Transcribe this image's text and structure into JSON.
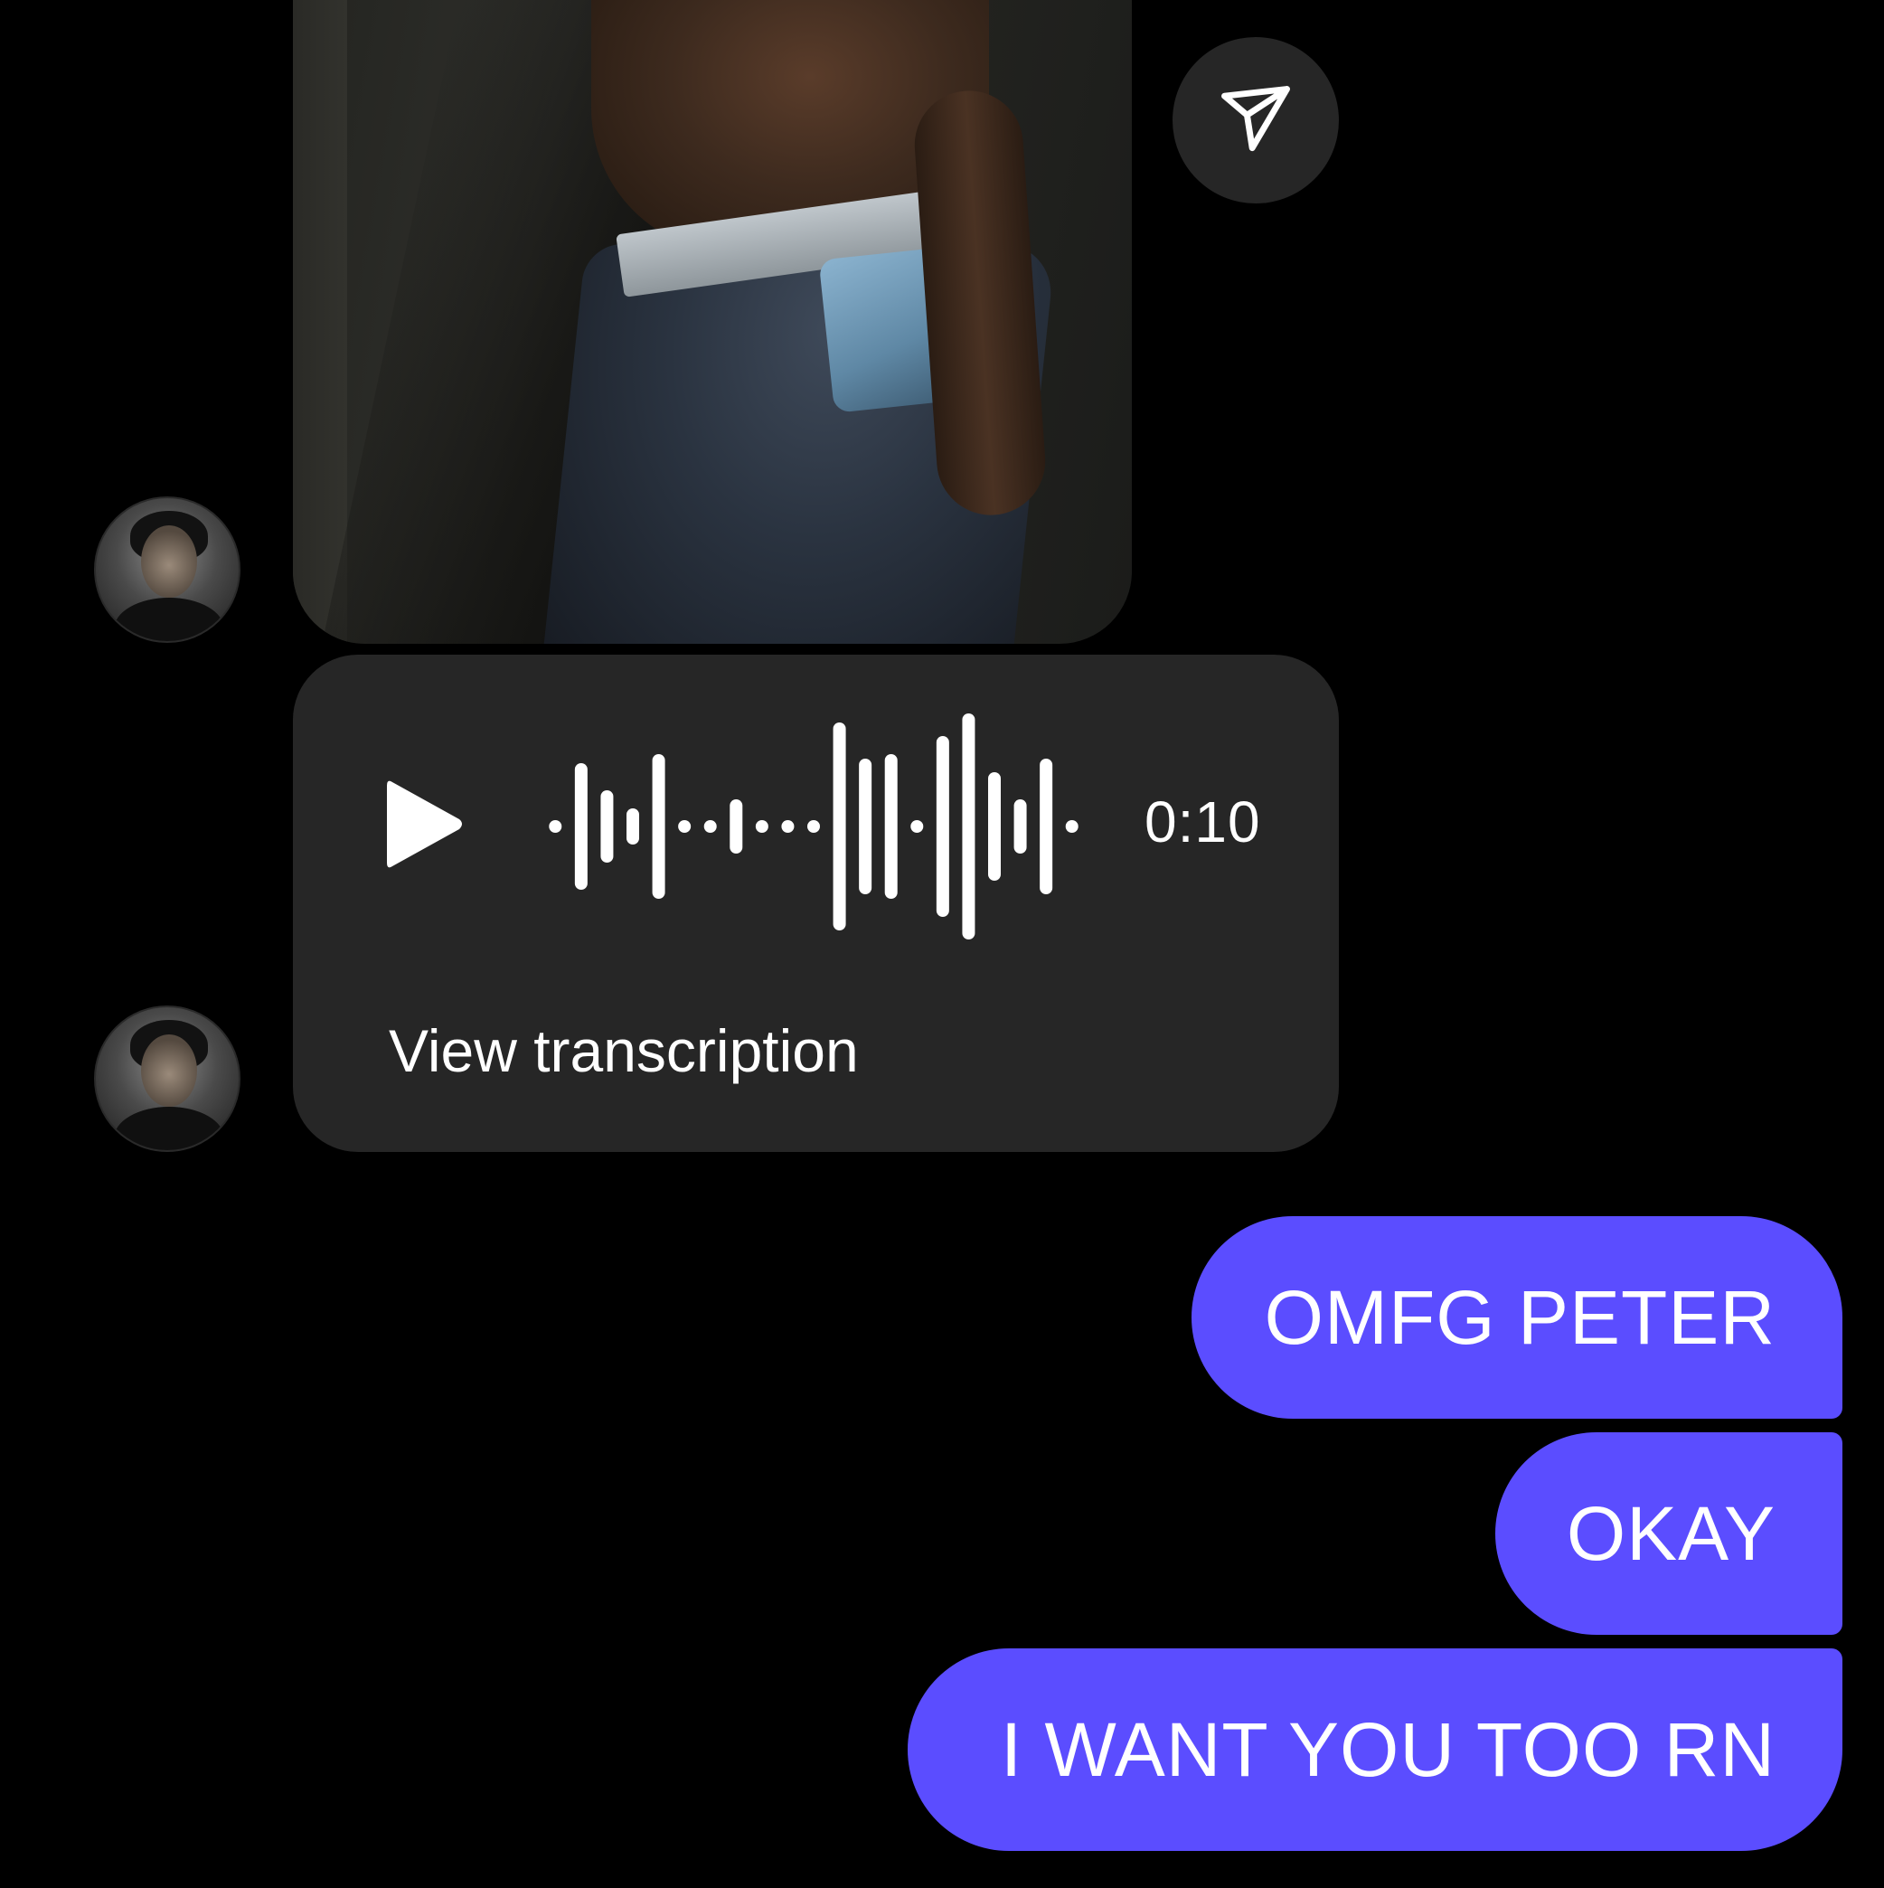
{
  "conversation": {
    "incoming": {
      "photo": {
        "icon": "photo-message-image"
      },
      "share_button": {
        "icon": "send-share-icon"
      },
      "voice_message": {
        "duration": "0:10",
        "transcription_label": "View transcription",
        "play_icon": "play-icon",
        "waveform_icon": "waveform-icon"
      }
    },
    "outgoing": [
      {
        "text": "OMFG PETER"
      },
      {
        "text": "OKAY"
      },
      {
        "text": "I WANT YOU TOO RN"
      }
    ]
  },
  "colors": {
    "background": "#000000",
    "incoming_bubble": "#262626",
    "outgoing_bubble": "#5b4dff",
    "text": "#ffffff"
  }
}
